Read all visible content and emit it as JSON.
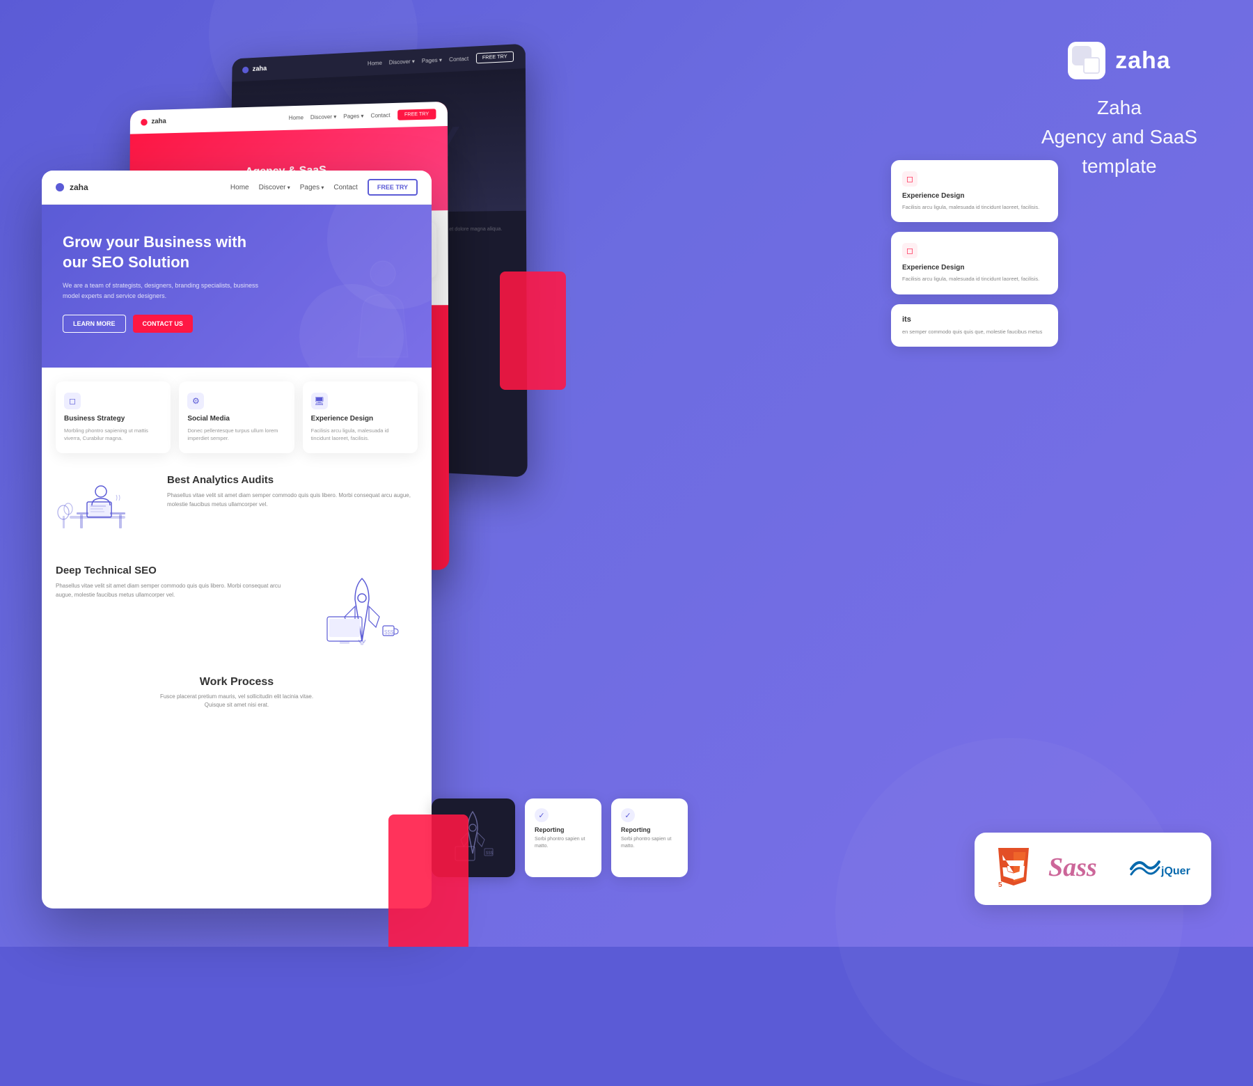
{
  "brand": {
    "name": "zaha",
    "tagline": "Zaha\nAgency and SaaS\ntemplate"
  },
  "nav": {
    "logo": "zaha",
    "links": [
      "Home",
      "Discover",
      "Pages",
      "Contact"
    ],
    "cta": "FREE TRY"
  },
  "hero": {
    "title": "Grow your Business with\nour SEO Solution",
    "subtitle": "We are a team of strategists, designers, branding specialists, business\nmodel experts and service designers.",
    "btn_learn": "LEARN MORE",
    "btn_contact": "CONTACT US"
  },
  "features": [
    {
      "icon": "◻",
      "title": "Business Strategy",
      "text": "Morbling phontro sapiening ut mattis viverra, Curabilur magna."
    },
    {
      "icon": "⚙",
      "title": "Social Media",
      "text": "Donec pellentesque turpus ullum lorem imperdiet semper."
    },
    {
      "icon": "🖥",
      "title": "Experience Design",
      "text": "Facilisis arcu ligula, malesuada id tincidunt laoreet, facilisis."
    }
  ],
  "analytics": {
    "title": "Best Analytics Audits",
    "text": "Phasellus vitae velit sit amet diam semper commodo quis quis libero. Morbi consequat arcu augue, molestie faucibus metus ullamcorper vel."
  },
  "seo": {
    "title": "Deep Technical SEO",
    "text": "Phasellus vitae velit sit amet diam semper commodo quis quis libero. Morbi consequat arcu augue, molestie faucibus metus ullamcorper vel."
  },
  "work": {
    "title": "Work Process",
    "text": "Fusce placerat pretium mauris, vel sollicitudin elit lacinia vitae.\nQuisque sit amet nisi erat."
  },
  "right_cards": [
    {
      "title": "Experience Design",
      "text": "Facilisis arcu ligula, malesuada id tincidunt laoreet, facilisis."
    },
    {
      "title": "Experience Design",
      "text": "Facilisis arcu ligula, malesuada id tincidunt laoreet, facilisis."
    },
    {
      "its_label": "its",
      "text": "en semper commodo quis quis que, molestie faucibus metus"
    }
  ],
  "reporting_cards": [
    {
      "title": "Reporting",
      "text": "Sorbi phontro sapien ut matto."
    },
    {
      "title": "Reporting",
      "text": "Sorbi phontro sapien ut matto."
    }
  ],
  "tech": {
    "html5": "HTML5",
    "sass": "Sass",
    "jquery": "jQuery"
  }
}
